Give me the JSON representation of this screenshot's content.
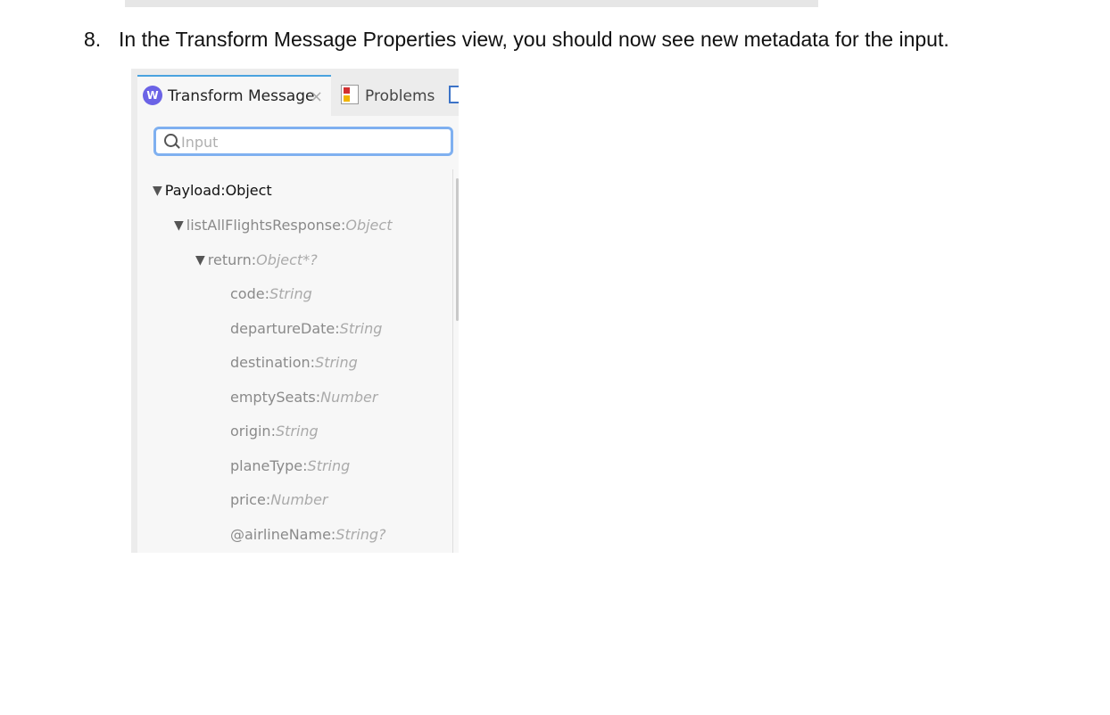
{
  "step": {
    "number": "8.",
    "text": "In the Transform Message Properties view, you should now see new metadata for the input."
  },
  "tabs": {
    "active_label": "Transform Message",
    "active_icon": "dataweave-icon",
    "close_glyph": "×",
    "problems_label": "Problems",
    "problems_icon": "problems-icon",
    "other_icon": "console-icon"
  },
  "search": {
    "placeholder": "Input",
    "value": ""
  },
  "tree": {
    "root": {
      "name": "Payload",
      "separator": " : ",
      "type": "Object"
    },
    "level1": {
      "name": "listAllFlightsResponse",
      "separator": " : ",
      "type": "Object"
    },
    "level2": {
      "name": "return",
      "separator": " : ",
      "type": "Object*?"
    },
    "fields": [
      {
        "name": "code",
        "separator": " : ",
        "type": "String"
      },
      {
        "name": "departureDate",
        "separator": " : ",
        "type": "String"
      },
      {
        "name": "destination",
        "separator": " : ",
        "type": "String"
      },
      {
        "name": "emptySeats",
        "separator": " : ",
        "type": "Number"
      },
      {
        "name": "origin",
        "separator": " : ",
        "type": "String"
      },
      {
        "name": "planeType",
        "separator": " : ",
        "type": "String"
      },
      {
        "name": "price",
        "separator": " : ",
        "type": "Number"
      },
      {
        "name": "@airlineName",
        "separator": " : ",
        "type": "String?"
      }
    ]
  },
  "colors": {
    "accent": "#4aa3df",
    "dataweave": "#6b63e6",
    "search_border": "#7fb0f0"
  }
}
